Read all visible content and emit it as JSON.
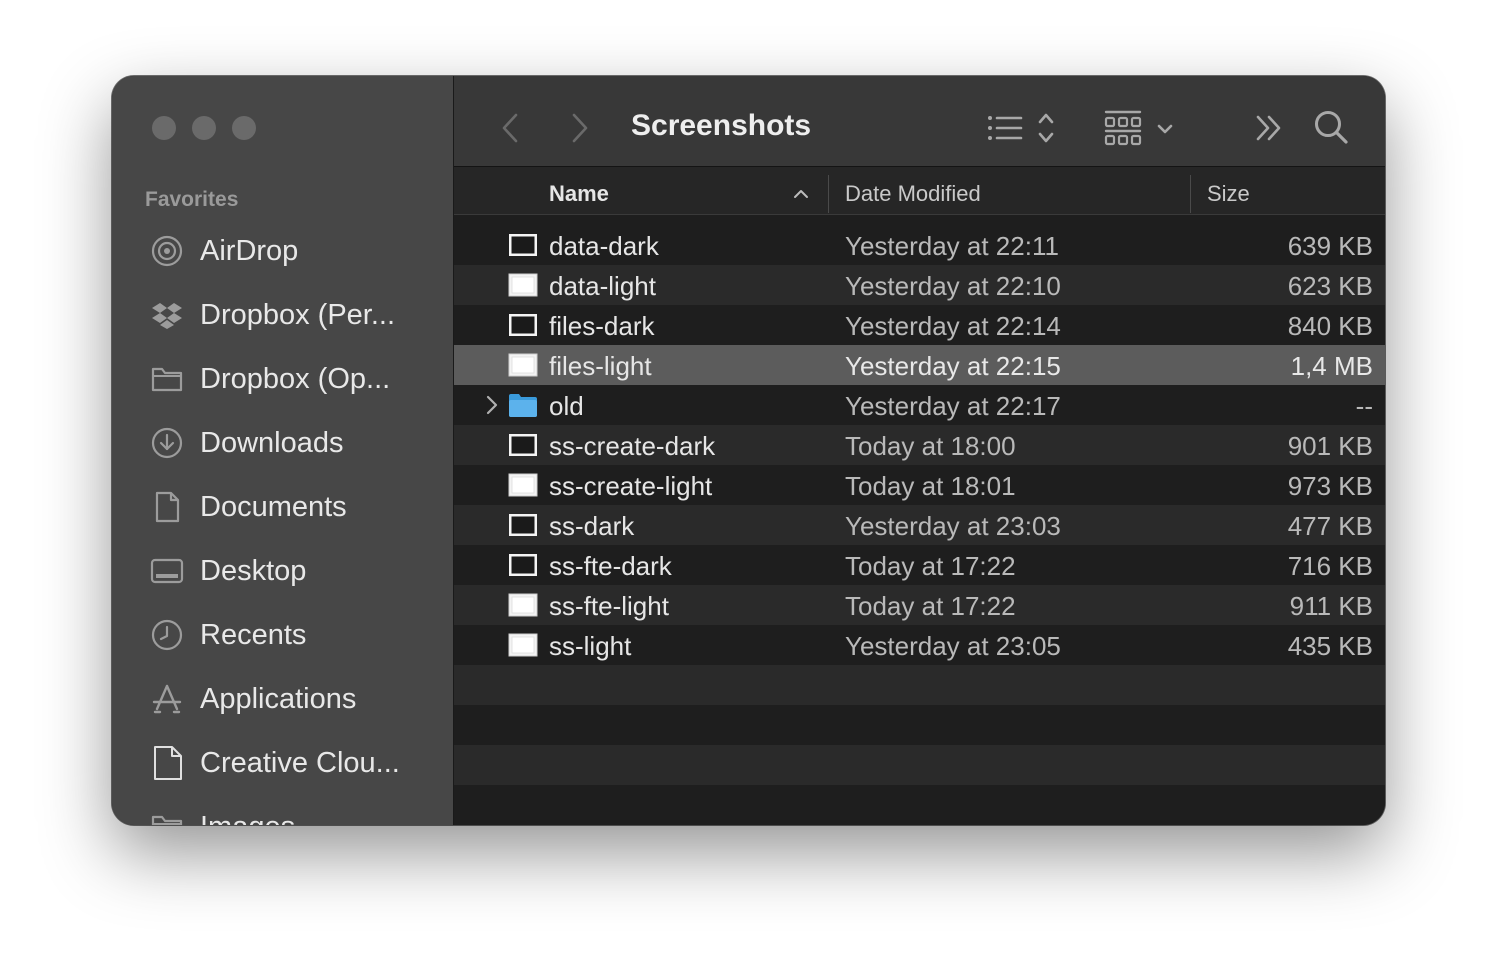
{
  "window": {
    "title": "Screenshots"
  },
  "sidebar": {
    "heading": "Favorites",
    "items": [
      {
        "label": "AirDrop",
        "icon": "airdrop-icon"
      },
      {
        "label": "Dropbox (Per...",
        "icon": "dropbox-icon"
      },
      {
        "label": "Dropbox (Op...",
        "icon": "folder-icon"
      },
      {
        "label": "Downloads",
        "icon": "downloads-icon"
      },
      {
        "label": "Documents",
        "icon": "document-icon"
      },
      {
        "label": "Desktop",
        "icon": "desktop-icon"
      },
      {
        "label": "Recents",
        "icon": "clock-icon"
      },
      {
        "label": "Applications",
        "icon": "applications-icon"
      },
      {
        "label": "Creative Clou...",
        "icon": "file-icon"
      },
      {
        "label": "Images",
        "icon": "folder-icon"
      }
    ]
  },
  "toolbar": {
    "back": "back-icon",
    "forward": "forward-icon",
    "list_view": "list-view-icon",
    "group": "group-icon",
    "more": "more-icon",
    "search": "search-icon"
  },
  "columns": {
    "name": "Name",
    "date": "Date Modified",
    "size": "Size"
  },
  "files": [
    {
      "name": "data-dark",
      "date": "Yesterday at 22:11",
      "size": "639 KB",
      "kind": "dark"
    },
    {
      "name": "data-light",
      "date": "Yesterday at 22:10",
      "size": "623 KB",
      "kind": "light"
    },
    {
      "name": "files-dark",
      "date": "Yesterday at 22:14",
      "size": "840 KB",
      "kind": "dark"
    },
    {
      "name": "files-light",
      "date": "Yesterday at 22:15",
      "size": "1,4 MB",
      "kind": "light",
      "selected": true
    },
    {
      "name": "old",
      "date": "Yesterday at 22:17",
      "size": "--",
      "kind": "folder"
    },
    {
      "name": "ss-create-dark",
      "date": "Today at 18:00",
      "size": "901 KB",
      "kind": "dark"
    },
    {
      "name": "ss-create-light",
      "date": "Today at 18:01",
      "size": "973 KB",
      "kind": "light"
    },
    {
      "name": "ss-dark",
      "date": "Yesterday at 23:03",
      "size": "477 KB",
      "kind": "dark"
    },
    {
      "name": "ss-fte-dark",
      "date": "Today at 17:22",
      "size": "716 KB",
      "kind": "dark"
    },
    {
      "name": "ss-fte-light",
      "date": "Today at 17:22",
      "size": "911 KB",
      "kind": "light"
    },
    {
      "name": "ss-light",
      "date": "Yesterday at 23:05",
      "size": "435 KB",
      "kind": "light"
    }
  ],
  "colors": {
    "sidebar": "#474747",
    "toolbar": "#383838",
    "selected_row": "#5c5c5c",
    "folder_blue": "#3a9bdc"
  }
}
